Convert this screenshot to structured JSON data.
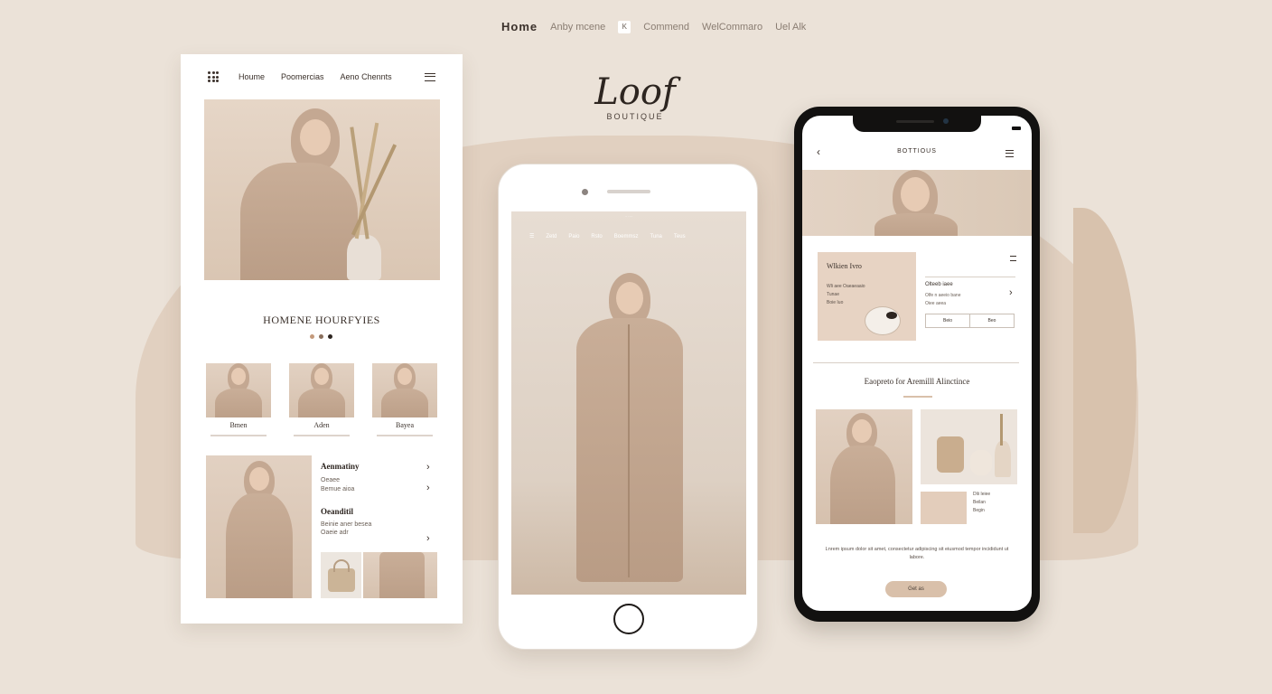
{
  "top_nav": {
    "items": [
      "Home",
      "Anby mcene",
      "Commend",
      "WelCommaro",
      "Uel Alk"
    ],
    "chip": "K"
  },
  "logo": {
    "script": "Loof",
    "sub": "BOUTIQUE"
  },
  "left_card": {
    "nav": [
      "Houme",
      "Poomercias",
      "Aeno Chennts"
    ],
    "section_title": "HOMENE HOURFYIES",
    "thumbs": [
      "Bmen",
      "Aden",
      "Bayea"
    ],
    "list": [
      {
        "title": "Aenmatiny",
        "sub": [
          "Oeaee",
          "Bemue aioa"
        ]
      },
      {
        "title": "Oeanditil",
        "sub": [
          "Beinie aner besea",
          "Oaeie adr"
        ]
      }
    ]
  },
  "center_phone": {
    "status": "·· ····",
    "nav": [
      "Zetd",
      "Paio",
      "Rsto",
      "Boemmsz",
      "Tuna",
      "Teus"
    ]
  },
  "right_phone": {
    "header": "BOTTIOUS",
    "card_title": "Wlkien Ivro",
    "card_text": [
      "Wli aee Oaeaeaaio",
      "Tunae",
      "Boie Iuo"
    ],
    "info_title": "Olteeb iaee",
    "info_text": [
      "Olfe n aeeio bane",
      "Oiee aeea"
    ],
    "buttons": [
      "Beio",
      "Beo"
    ],
    "section_title": "Eaopreto for Aremilll Alinctince",
    "side_text": [
      "Dlii Ieiee",
      "Beilan",
      "Begin"
    ],
    "footer": "Lnrem ipsum dolor sit amet, consectetur adipiscing sit eiusmod tempor incididunt ut labore.",
    "cta": "Get as"
  },
  "colors": {
    "background": "#ebe2d8",
    "accent": "#d9c0aa",
    "dots": [
      "#c49a7c",
      "#8a6f5c",
      "#2d2520"
    ]
  }
}
